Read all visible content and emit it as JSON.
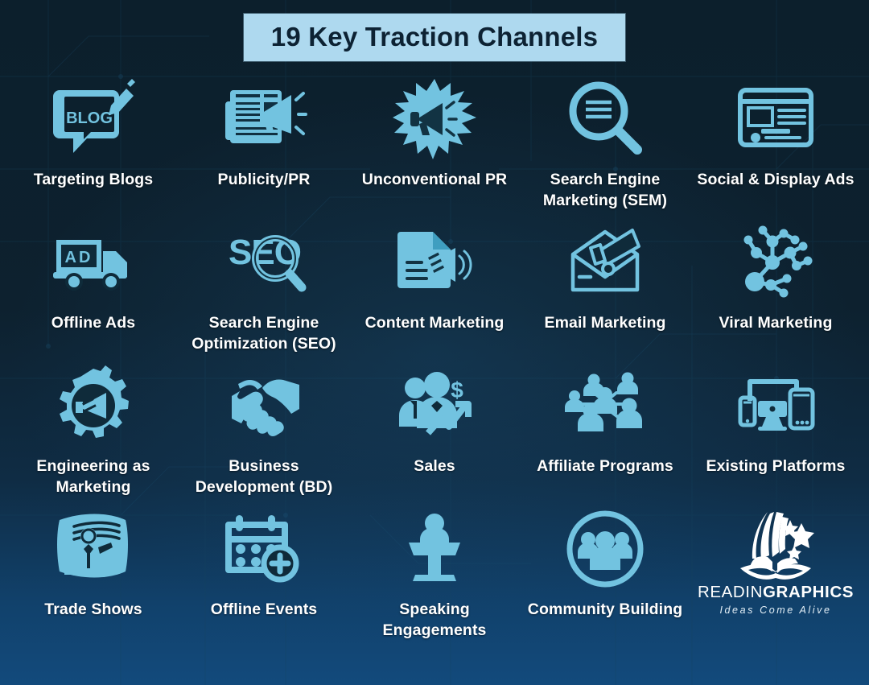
{
  "title": "19 Key Traction Channels",
  "colors": {
    "icon": "#72c3e0",
    "background_top": "#0c1f2c",
    "background_bottom": "#124a7c",
    "title_banner_bg": "#aed9ef",
    "title_text": "#0d2233",
    "label_text": "#ffffff"
  },
  "channels": [
    {
      "label": "Targeting Blogs",
      "icon": "blog-speech-bubble-pencil-icon",
      "icon_text": "BLOG"
    },
    {
      "label": "Publicity/PR",
      "icon": "newspaper-megaphone-icon"
    },
    {
      "label": "Unconventional PR",
      "icon": "starburst-megaphone-icon"
    },
    {
      "label": "Search Engine Marketing (SEM)",
      "icon": "magnifier-document-icon"
    },
    {
      "label": "Social & Display Ads",
      "icon": "browser-banner-ad-icon"
    },
    {
      "label": "Offline Ads",
      "icon": "ad-delivery-truck-icon",
      "icon_text": "AD"
    },
    {
      "label": "Search Engine Optimization (SEO)",
      "icon": "seo-magnifier-icon",
      "icon_text": "SEO"
    },
    {
      "label": "Content Marketing",
      "icon": "document-megaphone-icon"
    },
    {
      "label": "Email Marketing",
      "icon": "envelope-megaphone-icon"
    },
    {
      "label": "Viral Marketing",
      "icon": "network-nodes-icon"
    },
    {
      "label": "Engineering as Marketing",
      "icon": "gear-megaphone-icon"
    },
    {
      "label": "Business Development (BD)",
      "icon": "handshake-icon"
    },
    {
      "label": "Sales",
      "icon": "salespeople-dollar-growth-icon"
    },
    {
      "label": "Affiliate Programs",
      "icon": "people-network-icon"
    },
    {
      "label": "Existing Platforms",
      "icon": "multi-device-icon"
    },
    {
      "label": "Trade Shows",
      "icon": "trade-show-booth-icon"
    },
    {
      "label": "Offline Events",
      "icon": "calendar-plus-icon"
    },
    {
      "label": "Speaking Engagements",
      "icon": "podium-speaker-icon"
    },
    {
      "label": "Community Building",
      "icon": "people-circle-icon"
    }
  ],
  "logo": {
    "name_part1": "READIN",
    "name_part2": "GRAPHICS",
    "tagline": "Ideas Come Alive",
    "mark": "open-book-stars-icon"
  }
}
